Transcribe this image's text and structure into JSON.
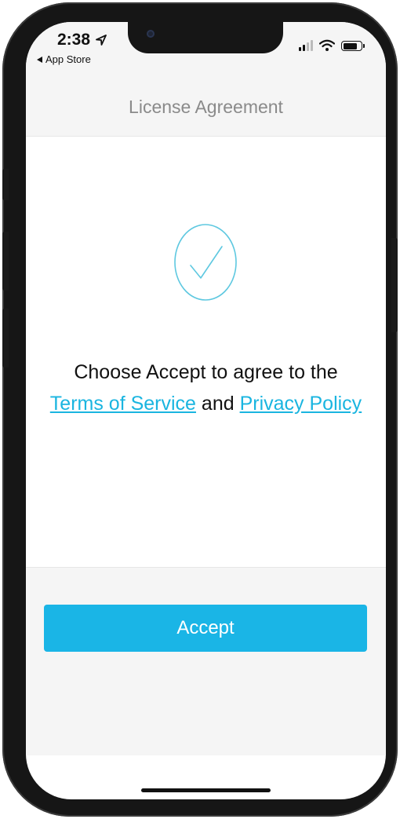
{
  "status_bar": {
    "time": "2:38",
    "back_app_label": "App Store"
  },
  "header": {
    "title": "License Agreement"
  },
  "content": {
    "message_line1": "Choose Accept to agree to the",
    "terms_link": "Terms of Service",
    "and_text": "and",
    "privacy_link": "Privacy Policy"
  },
  "footer": {
    "accept_label": "Accept"
  },
  "colors": {
    "accent": "#1ab5e6",
    "link": "#1ab5e0",
    "header_bg": "#f5f5f5",
    "header_text": "#8a8a8a"
  },
  "icons": [
    "location-arrow-icon",
    "back-arrow-icon",
    "cellular-signal-icon",
    "wifi-icon",
    "battery-icon",
    "checkmark-circle-icon"
  ]
}
